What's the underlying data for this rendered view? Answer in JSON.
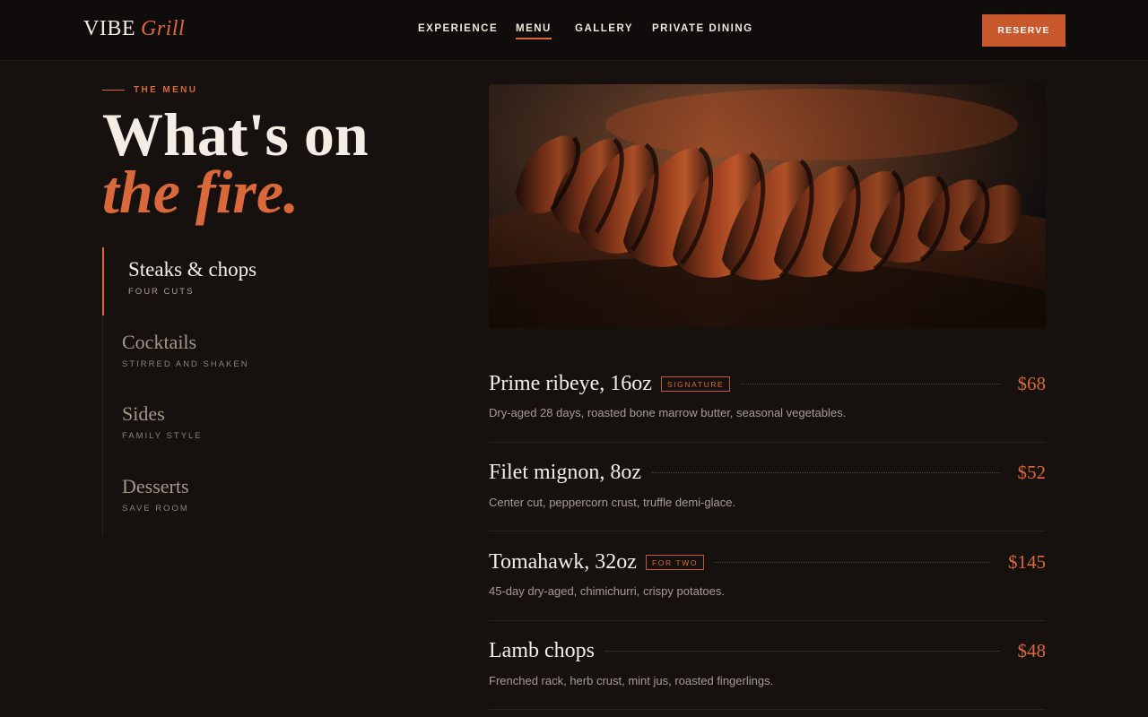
{
  "brand": {
    "name": "VIBE",
    "accent": "Grill"
  },
  "nav": {
    "items": [
      {
        "label": "EXPERIENCE",
        "active": false
      },
      {
        "label": "MENU",
        "active": true
      },
      {
        "label": "GALLERY",
        "active": false
      },
      {
        "label": "PRIVATE DINING",
        "active": false
      }
    ],
    "cta_label": "RESERVE"
  },
  "intro": {
    "eyebrow": "THE MENU",
    "headline_line1": "What's on",
    "headline_line2": "the fire."
  },
  "categories": [
    {
      "name": "Steaks & chops",
      "sub": "FOUR CUTS",
      "active": true
    },
    {
      "name": "Cocktails",
      "sub": "STIRRED AND SHAKEN",
      "active": false
    },
    {
      "name": "Sides",
      "sub": "FAMILY STYLE",
      "active": false
    },
    {
      "name": "Desserts",
      "sub": "SAVE ROOM",
      "active": false
    }
  ],
  "menu_items": [
    {
      "title": "Prime ribeye, 16oz",
      "badge": "SIGNATURE",
      "price": "$68",
      "desc": "Dry-aged 28 days, roasted bone marrow butter, seasonal vegetables."
    },
    {
      "title": "Filet mignon, 8oz",
      "badge": "",
      "price": "$52",
      "desc": "Center cut, peppercorn crust, truffle demi-glace."
    },
    {
      "title": "Tomahawk, 32oz",
      "badge": "FOR TWO",
      "price": "$145",
      "desc": "45-day dry-aged, chimichurri, crispy potatoes."
    },
    {
      "title": "Lamb chops",
      "badge": "",
      "price": "$48",
      "desc": "Frenched rack, herb crust, mint jus, roasted fingerlings."
    }
  ],
  "colors": {
    "background": "#16110f",
    "header": "#0f0c0b",
    "accent": "#d9693a",
    "cta": "#c9592d",
    "text": "#f3ede5",
    "muted": "#a79c91"
  }
}
